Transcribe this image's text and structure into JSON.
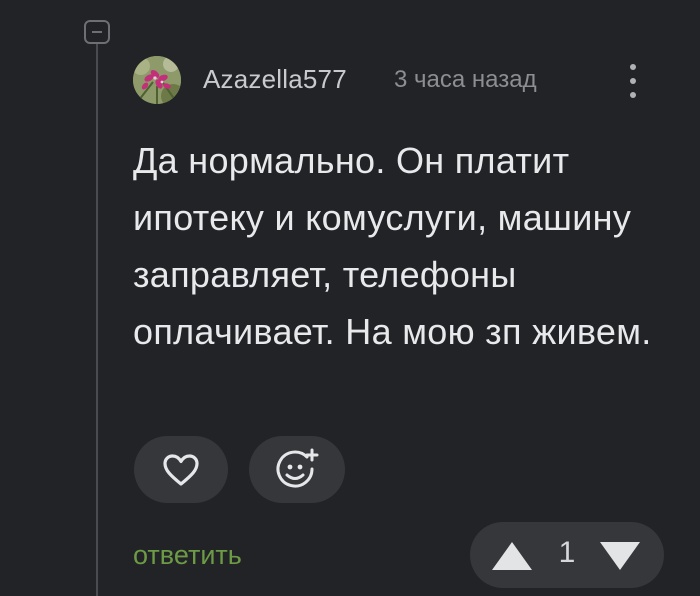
{
  "comment": {
    "username": "Azazella577",
    "timestamp": "3 часа назад",
    "text": "Да нормально. Он платит ипотеку и комуслуги, машину заправляет, телефоны оплачивает. На мою зп живем."
  },
  "actions": {
    "reply_label": "ответить",
    "vote_count": "1"
  },
  "icons": {
    "collapse": "collapse-minus-icon",
    "more": "more-vertical-icon",
    "like": "heart-icon",
    "reaction": "emoji-add-icon",
    "upvote": "triangle-up-icon",
    "downvote": "triangle-down-icon"
  },
  "colors": {
    "background": "#222326",
    "text": "#e8e9eb",
    "username": "#c9cacd",
    "muted": "#8d8e92",
    "reply": "#6c9a45",
    "button": "#36373b"
  }
}
